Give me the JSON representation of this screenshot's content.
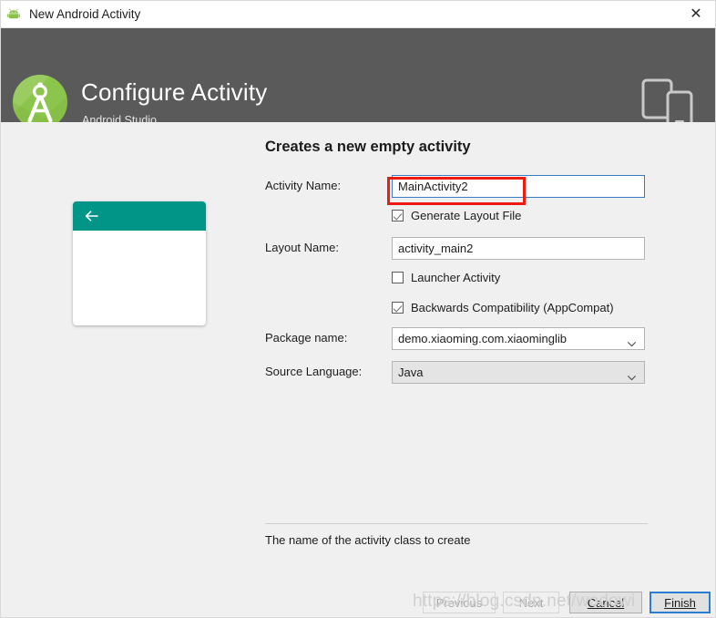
{
  "window": {
    "title": "New Android Activity",
    "icon": "android-robot-icon",
    "close_label": "✕"
  },
  "header": {
    "title": "Configure Activity",
    "subtitle": "Android Studio",
    "logo": "android-studio-logo",
    "devices_icon": "tablet-phone-icon",
    "background": "#5a5a5a"
  },
  "preview": {
    "appbar_color": "#009587",
    "back_icon": "arrow-back-icon"
  },
  "main": {
    "section_title": "Creates a new empty activity",
    "fields": {
      "activity_name": {
        "label": "Activity Name:",
        "value": "MainActivity2",
        "placeholder": ""
      },
      "layout_name": {
        "label": "Layout Name:",
        "value": "activity_main2",
        "placeholder": ""
      },
      "package_name": {
        "label": "Package name:",
        "value": "demo.xiaoming.com.xiaominglib",
        "arrow": "chevron-down-icon"
      },
      "source_language": {
        "label": "Source Language:",
        "value": "Java",
        "arrow": "chevron-down-icon"
      }
    },
    "checkboxes": [
      {
        "label": "Generate Layout File",
        "checked": true
      },
      {
        "label": "Launcher Activity",
        "checked": false
      },
      {
        "label": "Backwards Compatibility (AppCompat)",
        "checked": true
      }
    ],
    "hint": "The name of the activity class to create"
  },
  "footer": {
    "buttons": [
      {
        "label": "Previous",
        "state": "disabled"
      },
      {
        "label": "Next",
        "state": "disabled"
      },
      {
        "label": "Cancel",
        "state": "enabled"
      },
      {
        "label": "Finish",
        "state": "default"
      }
    ]
  },
  "overlay": {
    "watermark": "https://blog.csdn.net/wodowi",
    "annotation_color": "#ee1c10"
  }
}
